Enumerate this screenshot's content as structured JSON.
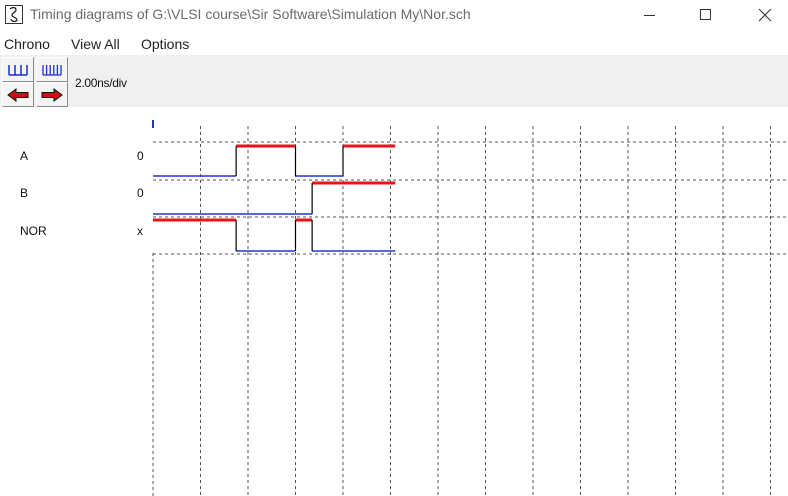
{
  "window": {
    "title": "Timing diagrams of G:\\VLSI course\\Sir Software\\Simulation My\\Nor.sch",
    "icon": "lambda-icon",
    "controls": [
      "minimize-icon",
      "maximize-icon",
      "close-icon"
    ]
  },
  "menu": {
    "items": [
      {
        "label": "Chrono"
      },
      {
        "label": "View All"
      },
      {
        "label": "Options"
      }
    ]
  },
  "toolbar": {
    "zoom_out_icon": "comb-coarse-icon",
    "zoom_in_icon": "comb-fine-icon",
    "scroll_left_icon": "arrow-left-icon",
    "scroll_right_icon": "arrow-right-icon",
    "scale": "2.00ns/div"
  },
  "signals": [
    {
      "name": "A",
      "value": "0"
    },
    {
      "name": "B",
      "value": "0"
    },
    {
      "name": "NOR",
      "value": "x"
    }
  ],
  "colors": {
    "high": "#e8141c",
    "low": "#2233cc",
    "edge": "#000000",
    "grid": "#555555",
    "cursor": "#2233cc"
  },
  "waveforms": {
    "time_per_div_ns": 2,
    "A": [
      [
        0,
        0
      ],
      [
        3.5,
        1
      ],
      [
        6,
        0
      ],
      [
        8,
        1
      ],
      [
        10.2,
        1
      ]
    ],
    "B": [
      [
        0,
        0
      ],
      [
        6.7,
        1
      ],
      [
        10.2,
        1
      ]
    ],
    "NOR": [
      [
        0,
        1
      ],
      [
        3.5,
        0
      ],
      [
        6,
        1
      ],
      [
        6.7,
        0
      ],
      [
        10.2,
        0
      ]
    ]
  }
}
